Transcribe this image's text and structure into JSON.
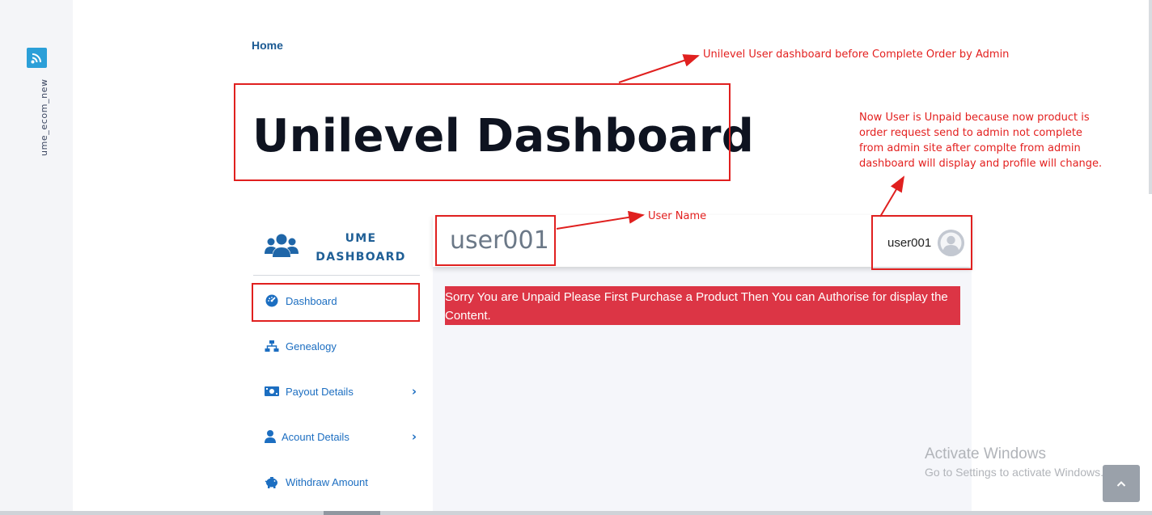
{
  "site": {
    "name": "ume_ecom_new",
    "logo_icon": "wifi-signal-icon",
    "logo_color": "#2b9fd8"
  },
  "breadcrumb": {
    "home_label": "Home"
  },
  "page": {
    "title": "Unilevel Dashboard"
  },
  "sidebar": {
    "brand_icon": "users-group-icon",
    "brand_line1": "UME",
    "brand_line2": "DASHBOARD",
    "items": [
      {
        "label": "Dashboard",
        "icon": "tachometer-icon",
        "has_submenu": false
      },
      {
        "label": "Genealogy",
        "icon": "sitemap-icon",
        "has_submenu": false
      },
      {
        "label": "Payout Details",
        "icon": "money-bill-icon",
        "has_submenu": true
      },
      {
        "label": "Acount Details",
        "icon": "user-icon",
        "has_submenu": true
      },
      {
        "label": "Withdraw Amount",
        "icon": "piggy-bank-icon",
        "has_submenu": false
      }
    ]
  },
  "topbar": {
    "user_heading": "user001",
    "profile_name": "user001",
    "avatar_icon": "default-avatar-icon"
  },
  "alert": {
    "text": "Sorry You are Unpaid Please First Purchase a Product Then You can Authorise for display the Content.",
    "color": "#dc3545"
  },
  "annotations": {
    "color": "#e0201f",
    "dashboard_note": "Unilevel User dashboard before Complete Order by Admin",
    "user_name_note": "User Name",
    "unpaid_note_lines": [
      "Now User is Unpaid because now product is",
      "order request send to admin not complete",
      "from admin site after complte from admin",
      "dashboard will display and profile will change."
    ]
  },
  "watermark": {
    "title": "Activate Windows",
    "subtitle": "Go to Settings to activate Windows."
  },
  "scroll_top_icon": "chevron-up-icon"
}
